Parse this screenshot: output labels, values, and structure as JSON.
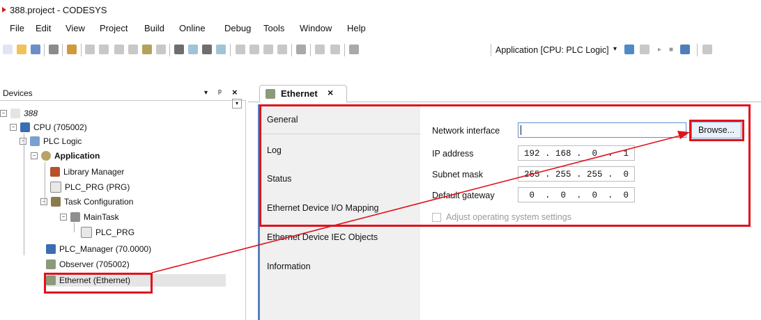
{
  "window": {
    "title": "388.project - CODESYS"
  },
  "menu": [
    "File",
    "Edit",
    "View",
    "Project",
    "Build",
    "Online",
    "Debug",
    "Tools",
    "Window",
    "Help"
  ],
  "toolbar": {
    "application_selector": "Application [CPU: PLC Logic]"
  },
  "devices": {
    "header": "Devices",
    "tree": [
      {
        "label": "388",
        "indent": 0,
        "icon": "project-icon",
        "italic": true
      },
      {
        "label": "CPU (705002)",
        "indent": 1,
        "icon": "cpu-icon"
      },
      {
        "label": "PLC Logic",
        "indent": 2,
        "icon": "plc-logic-icon"
      },
      {
        "label": "Application",
        "indent": 3,
        "icon": "application-icon",
        "bold": true
      },
      {
        "label": "Library Manager",
        "indent": 4,
        "icon": "library-icon"
      },
      {
        "label": "PLC_PRG (PRG)",
        "indent": 4,
        "icon": "program-icon"
      },
      {
        "label": "Task Configuration",
        "indent": 4,
        "icon": "task-config-icon"
      },
      {
        "label": "MainTask",
        "indent": 5,
        "icon": "task-icon"
      },
      {
        "label": "PLC_PRG",
        "indent": 6,
        "icon": "program-call-icon"
      },
      {
        "label": "PLC_Manager (70.0000)",
        "indent": 1,
        "icon": "plc-manager-icon"
      },
      {
        "label": "Observer (705002)",
        "indent": 1,
        "icon": "device-icon"
      },
      {
        "label": "Ethernet (Ethernet)",
        "indent": 1,
        "icon": "device-icon",
        "selected": true
      }
    ]
  },
  "editor": {
    "tab_label": "Ethernet",
    "nav": [
      "General",
      "Log",
      "Status",
      "Ethernet Device I/O Mapping",
      "Ethernet Device IEC Objects",
      "Information"
    ],
    "fields": {
      "network_interface": {
        "label": "Network interface",
        "value": ""
      },
      "ip_address": {
        "label": "IP address",
        "value": "192 . 168 .  0  .  1"
      },
      "subnet_mask": {
        "label": "Subnet mask",
        "value": "255 . 255 . 255 .  0"
      },
      "default_gateway": {
        "label": "Default gateway",
        "value": " 0  .  0  .  0  .  0"
      }
    },
    "browse_label": "Browse...",
    "adjust_label": "Adjust operating system settings"
  },
  "colors": {
    "highlight": "#e0121b"
  }
}
